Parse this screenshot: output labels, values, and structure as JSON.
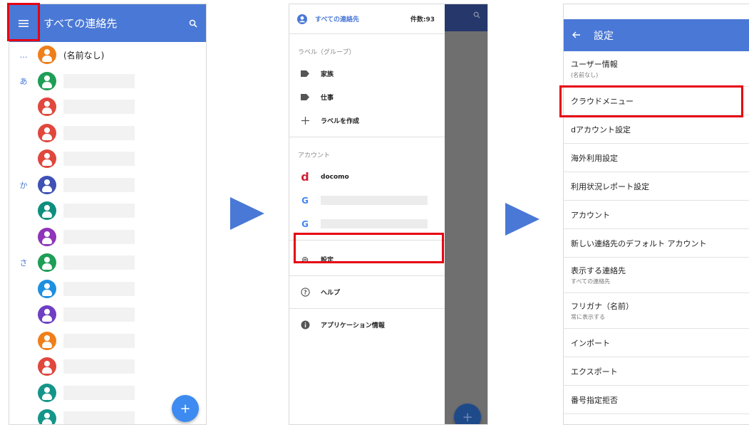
{
  "colors": {
    "primary": "#4a78d6",
    "highlight": "#e60012"
  },
  "screen1": {
    "title": "すべての連絡先",
    "fab_label": "+",
    "contacts": [
      {
        "index": "…",
        "name": "(名前なし)",
        "color": "#ef7f1a"
      },
      {
        "index": "あ",
        "name": "",
        "color": "#1e9e57"
      },
      {
        "index": "",
        "name": "",
        "color": "#e0473d"
      },
      {
        "index": "",
        "name": "",
        "color": "#e0473d"
      },
      {
        "index": "",
        "name": "",
        "color": "#e0473d"
      },
      {
        "index": "か",
        "name": "",
        "color": "#3f51b5"
      },
      {
        "index": "",
        "name": "",
        "color": "#0e8f7e"
      },
      {
        "index": "",
        "name": "",
        "color": "#8e35b8"
      },
      {
        "index": "さ",
        "name": "",
        "color": "#1e9e57"
      },
      {
        "index": "",
        "name": "",
        "color": "#1e90e0"
      },
      {
        "index": "",
        "name": "",
        "color": "#6e3fc4"
      },
      {
        "index": "",
        "name": "",
        "color": "#ef7f1a"
      },
      {
        "index": "",
        "name": "",
        "color": "#e0473d"
      },
      {
        "index": "",
        "name": "",
        "color": "#15958a"
      },
      {
        "index": "",
        "name": "",
        "color": "#15958a"
      }
    ]
  },
  "screen2": {
    "header_title": "すべての連絡先",
    "header_count": "件数:93",
    "labels_section": "ラベル（グループ）",
    "label_family": "家族",
    "label_work": "仕事",
    "create_label": "ラベルを作成",
    "account_section": "アカウント",
    "docomo_logo": "d",
    "google_logo": "G",
    "account_docomo": "docomo",
    "settings": "設定",
    "help": "ヘルプ",
    "app_info": "アプリケーション情報",
    "fab_label": "+"
  },
  "screen3": {
    "title": "設定",
    "items": [
      {
        "label": "ユーザー情報",
        "sub": "(名前なし)"
      },
      {
        "label": "クラウドメニュー",
        "sub": ""
      },
      {
        "label": "dアカウント設定",
        "sub": ""
      },
      {
        "label": "海外利用設定",
        "sub": ""
      },
      {
        "label": "利用状況レポート設定",
        "sub": ""
      },
      {
        "label": "アカウント",
        "sub": ""
      },
      {
        "label": "新しい連絡先のデフォルト アカウント",
        "sub": ""
      },
      {
        "label": "表示する連絡先",
        "sub": "すべての連絡先"
      },
      {
        "label": "フリガナ（名前）",
        "sub": "常に表示する"
      },
      {
        "label": "インポート",
        "sub": ""
      },
      {
        "label": "エクスポート",
        "sub": ""
      },
      {
        "label": "番号指定拒否",
        "sub": ""
      }
    ]
  }
}
